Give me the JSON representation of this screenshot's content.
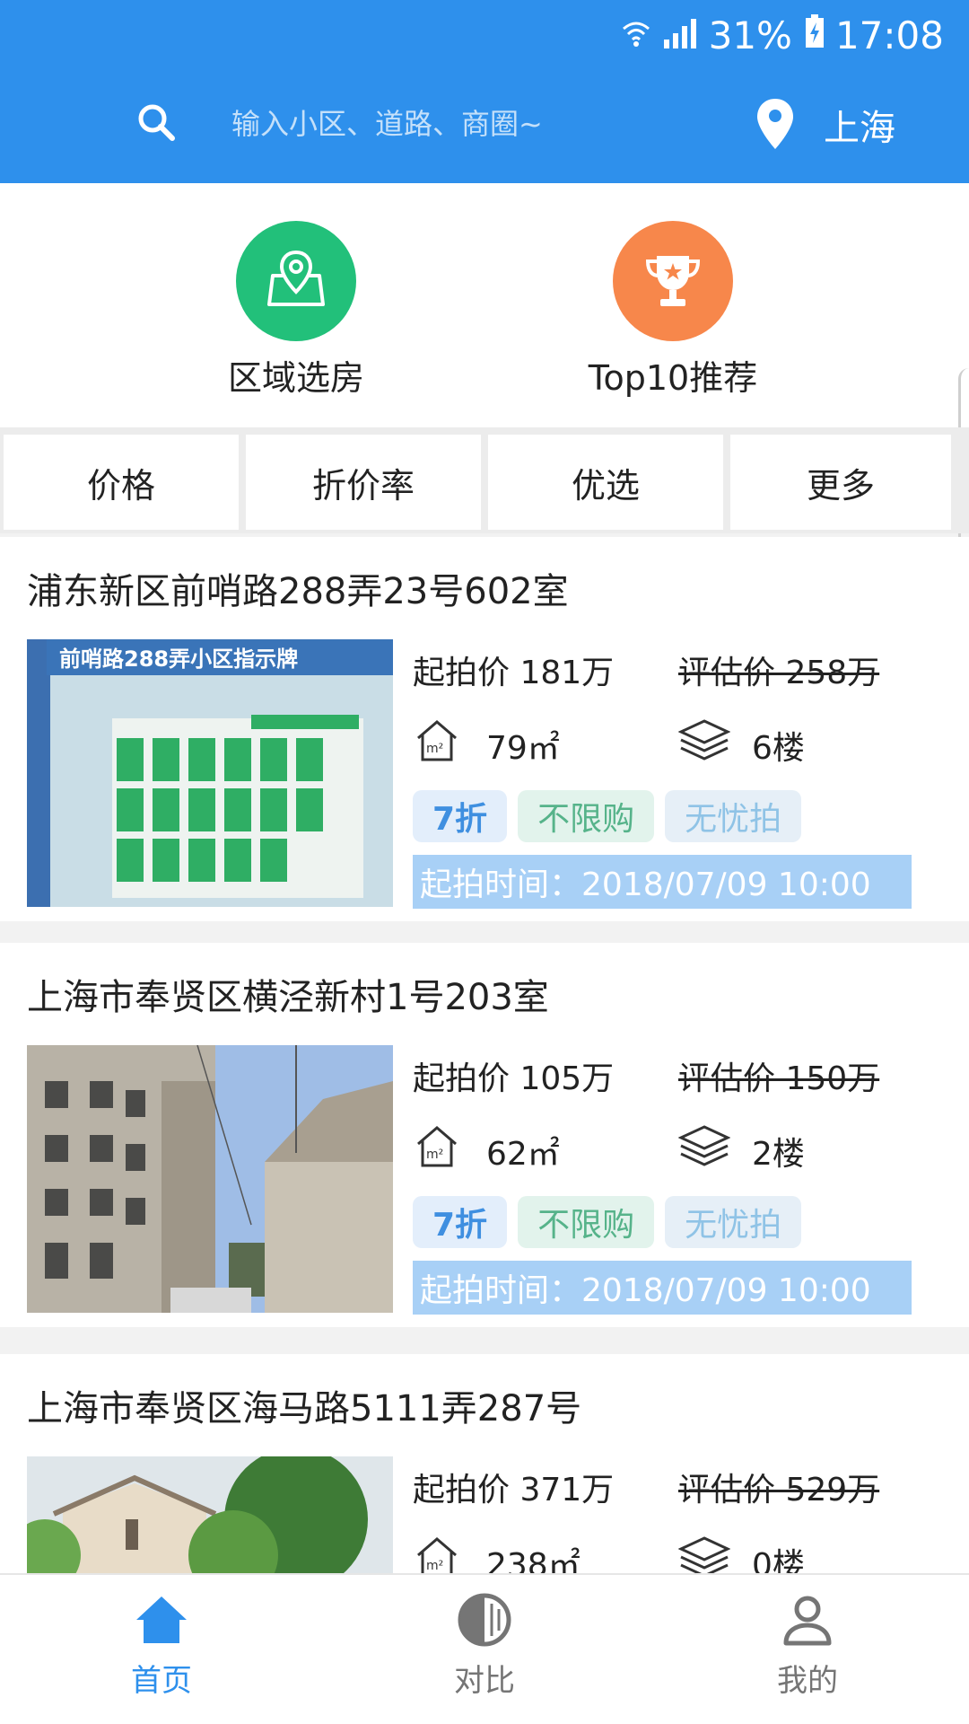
{
  "status": {
    "battery": "31%",
    "time": "17:08"
  },
  "search": {
    "placeholder": "输入小区、道路、商圈~"
  },
  "location": {
    "city": "上海"
  },
  "quick_entries": [
    {
      "label": "区域选房",
      "icon": "map-location-icon",
      "color": "#22c07a"
    },
    {
      "label": "Top10推荐",
      "icon": "trophy-icon",
      "color": "#f7874b"
    }
  ],
  "filters": [
    {
      "label": "价格"
    },
    {
      "label": "折价率"
    },
    {
      "label": "优选"
    },
    {
      "label": "更多"
    }
  ],
  "listings": [
    {
      "title": "浦东新区前哨路288弄23号602室",
      "start_price": "起拍价 181万",
      "eval_price": "评估价 258万",
      "area": "79㎡",
      "floor": "6楼",
      "tags": [
        "7折",
        "不限购",
        "无忧拍"
      ],
      "start_time": "起拍时间：2018/07/09 10:00",
      "image": "community-sign-photo",
      "sign_text": "前哨路288弄小区指示牌"
    },
    {
      "title": "上海市奉贤区横泾新村1号203室",
      "start_price": "起拍价 105万",
      "eval_price": "评估价 150万",
      "area": "62㎡",
      "floor": "2楼",
      "tags": [
        "7折",
        "不限购",
        "无忧拍"
      ],
      "start_time": "起拍时间：2018/07/09 10:00",
      "image": "old-apartment-building-photo"
    },
    {
      "title": "上海市奉贤区海马路5111弄287号",
      "start_price": "起拍价 371万",
      "eval_price": "评估价 529万",
      "area": "238㎡",
      "floor": "0楼",
      "image": "villa-with-trees-photo"
    }
  ],
  "nav": [
    {
      "label": "首页",
      "icon": "home-icon",
      "active": true
    },
    {
      "label": "对比",
      "icon": "compare-icon",
      "active": false
    },
    {
      "label": "我的",
      "icon": "person-icon",
      "active": false
    }
  ],
  "colors": {
    "primary": "#2e90ec",
    "active_nav": "#2e90ec",
    "inactive_nav": "#757575"
  }
}
